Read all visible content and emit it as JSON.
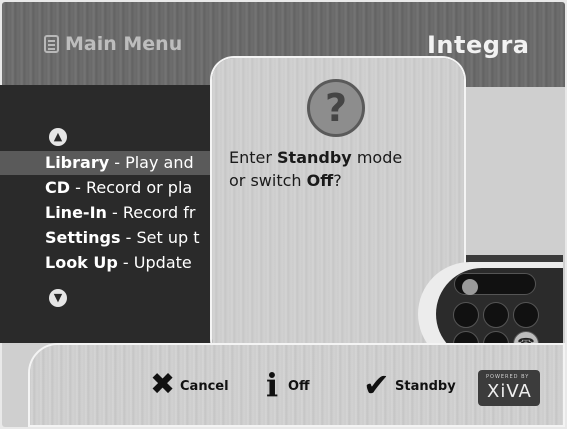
{
  "header": {
    "title": "Main Menu",
    "brand": "Integra"
  },
  "menu": {
    "items": [
      {
        "name": "Library",
        "desc": " - Play and",
        "selected": true
      },
      {
        "name": "CD",
        "desc": " - Record or pla",
        "selected": false
      },
      {
        "name": "Line-In",
        "desc": " - Record fr",
        "selected": false
      },
      {
        "name": "Settings",
        "desc": " - Set up t",
        "selected": false
      },
      {
        "name": "Look Up",
        "desc": " - Update",
        "selected": false
      }
    ]
  },
  "dialog": {
    "icon": "question-icon",
    "line1_prefix": "Enter ",
    "line1_bold": "Standby",
    "line1_suffix": " mode",
    "line2_prefix": "or switch ",
    "line2_bold": "Off",
    "line2_suffix": "?"
  },
  "actions": {
    "cancel_label": "Cancel",
    "off_label": "Off",
    "standby_label": "Standby"
  },
  "footer": {
    "powered_by": "POWERED BY",
    "logo": "XiVA"
  },
  "colors": {
    "panel_dark": "#2a2a2a",
    "selected_row": "#5a5a5a",
    "metal": "#cccccc"
  }
}
